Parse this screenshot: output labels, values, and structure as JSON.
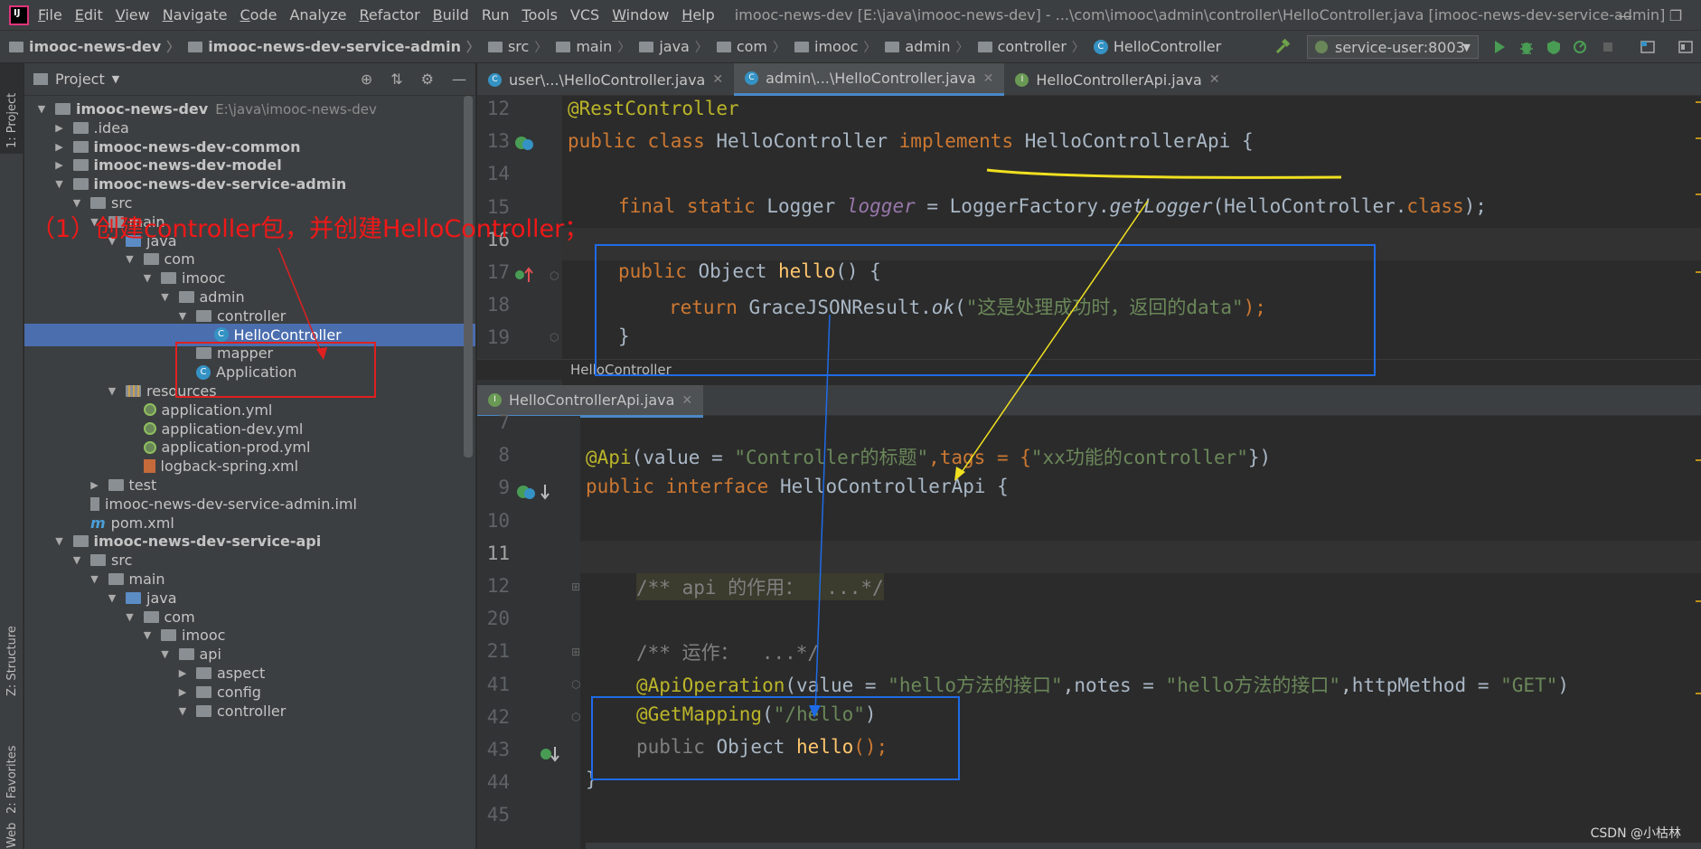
{
  "menubar": {
    "items": [
      {
        "label": "File",
        "u": "F",
        "rest": "ile"
      },
      {
        "label": "Edit",
        "u": "E",
        "rest": "dit"
      },
      {
        "label": "View",
        "u": "V",
        "rest": "iew"
      },
      {
        "label": "Navigate",
        "u": "N",
        "rest": "avigate"
      },
      {
        "label": "Code",
        "u": "C",
        "rest": "ode"
      },
      {
        "label": "Analyze",
        "u": "",
        "rest": "Analyze"
      },
      {
        "label": "Refactor",
        "u": "R",
        "rest": "efactor"
      },
      {
        "label": "Build",
        "u": "B",
        "rest": "uild"
      },
      {
        "label": "Run",
        "u": "",
        "rest": "Run"
      },
      {
        "label": "Tools",
        "u": "T",
        "rest": "ools"
      },
      {
        "label": "VCS",
        "u": "",
        "rest": "VCS"
      },
      {
        "label": "Window",
        "u": "W",
        "rest": "indow"
      },
      {
        "label": "Help",
        "u": "H",
        "rest": "elp"
      }
    ],
    "window_title": "imooc-news-dev [E:\\java\\imooc-news-dev] - ...\\com\\imooc\\admin\\controller\\HelloController.java [imooc-news-dev-service-admin]",
    "logo_text": "IJ"
  },
  "navbar": {
    "crumbs": [
      "imooc-news-dev",
      "imooc-news-dev-service-admin",
      "src",
      "main",
      "java",
      "com",
      "imooc",
      "admin",
      "controller",
      "HelloController"
    ],
    "run_config": "service-user:8003"
  },
  "stripe": {
    "project": "1: Project",
    "structure": "Z: Structure",
    "favorites": "2: Favorites",
    "web": "Web"
  },
  "project_panel": {
    "title": "Project",
    "tree": [
      {
        "label": "imooc-news-dev",
        "path": "E:\\java\\imooc-news-dev",
        "indent": 0,
        "tw": "▼",
        "icon": "folder",
        "bold": true
      },
      {
        "label": ".idea",
        "indent": 1,
        "tw": "▶",
        "icon": "folder"
      },
      {
        "label": "imooc-news-dev-common",
        "indent": 1,
        "tw": "▶",
        "icon": "folder",
        "bold": true
      },
      {
        "label": "imooc-news-dev-model",
        "indent": 1,
        "tw": "▶",
        "icon": "folder",
        "bold": true
      },
      {
        "label": "imooc-news-dev-service-admin",
        "indent": 1,
        "tw": "▼",
        "icon": "folder",
        "bold": true
      },
      {
        "label": "src",
        "indent": 2,
        "tw": "▼",
        "icon": "folder"
      },
      {
        "label": "main",
        "indent": 3,
        "tw": "▼",
        "icon": "folder"
      },
      {
        "label": "java",
        "indent": 4,
        "tw": "▼",
        "icon": "src"
      },
      {
        "label": "com",
        "indent": 5,
        "tw": "▼",
        "icon": "folder"
      },
      {
        "label": "imooc",
        "indent": 6,
        "tw": "▼",
        "icon": "folder"
      },
      {
        "label": "admin",
        "indent": 7,
        "tw": "▼",
        "icon": "folder"
      },
      {
        "label": "controller",
        "indent": 8,
        "tw": "▼",
        "icon": "folder"
      },
      {
        "label": "HelloController",
        "indent": 9,
        "tw": "",
        "icon": "class",
        "selected": true
      },
      {
        "label": "mapper",
        "indent": 8,
        "tw": "",
        "icon": "folder"
      },
      {
        "label": "Application",
        "indent": 8,
        "tw": "",
        "icon": "class"
      },
      {
        "label": "resources",
        "indent": 4,
        "tw": "▼",
        "icon": "res"
      },
      {
        "label": "application.yml",
        "indent": 5,
        "tw": "",
        "icon": "yml"
      },
      {
        "label": "application-dev.yml",
        "indent": 5,
        "tw": "",
        "icon": "yml"
      },
      {
        "label": "application-prod.yml",
        "indent": 5,
        "tw": "",
        "icon": "yml"
      },
      {
        "label": "logback-spring.xml",
        "indent": 5,
        "tw": "",
        "icon": "xml"
      },
      {
        "label": "test",
        "indent": 3,
        "tw": "▶",
        "icon": "folder"
      },
      {
        "label": "imooc-news-dev-service-admin.iml",
        "indent": 2,
        "tw": "",
        "icon": "iml"
      },
      {
        "label": "pom.xml",
        "indent": 2,
        "tw": "",
        "icon": "maven"
      },
      {
        "label": "imooc-news-dev-service-api",
        "indent": 1,
        "tw": "▼",
        "icon": "folder",
        "bold": true
      },
      {
        "label": "src",
        "indent": 2,
        "tw": "▼",
        "icon": "folder"
      },
      {
        "label": "main",
        "indent": 3,
        "tw": "▼",
        "icon": "folder"
      },
      {
        "label": "java",
        "indent": 4,
        "tw": "▼",
        "icon": "src"
      },
      {
        "label": "com",
        "indent": 5,
        "tw": "▼",
        "icon": "folder"
      },
      {
        "label": "imooc",
        "indent": 6,
        "tw": "▼",
        "icon": "folder"
      },
      {
        "label": "api",
        "indent": 7,
        "tw": "▼",
        "icon": "folder"
      },
      {
        "label": "aspect",
        "indent": 8,
        "tw": "▶",
        "icon": "folder"
      },
      {
        "label": "config",
        "indent": 8,
        "tw": "▶",
        "icon": "folder"
      },
      {
        "label": "controller",
        "indent": 8,
        "tw": "▼",
        "icon": "folder"
      }
    ]
  },
  "annotation": "（1）创建controller包，并创建HelloController；",
  "top_editor": {
    "tabs": [
      {
        "label": "user\\...\\HelloController.java",
        "kind": "class"
      },
      {
        "label": "admin\\...\\HelloController.java",
        "kind": "class",
        "active": true
      },
      {
        "label": "HelloControllerApi.java",
        "kind": "interface"
      }
    ],
    "breadcrumb": "HelloController",
    "lines": [
      "12",
      "13",
      "14",
      "15",
      "16",
      "17",
      "18",
      "19"
    ],
    "code": {
      "l12": "@RestController",
      "l13_kw1": "public class",
      "l13_name": " HelloController ",
      "l13_kw2": "implements",
      "l13_rest": " HelloControllerApi {",
      "l15_kw": "final static",
      "l15_a": " Logger ",
      "l15_fld": "logger",
      "l15_b": " = LoggerFactory.",
      "l15_it": "getLogger",
      "l15_c": "(HelloController.",
      "l15_kw2": "class",
      "l15_d": ");",
      "l17_kw": "public",
      "l17_a": " Object ",
      "l17_fn": "hello",
      "l17_b": "() {",
      "l18_kw": "return",
      "l18_a": " GraceJSONResult.",
      "l18_it": "ok",
      "l18_b": "(",
      "l18_str": "\"这是处理成功时，返回的data\"",
      "l18_c": ");",
      "l19": "}"
    }
  },
  "bottom_editor": {
    "tab": "HelloControllerApi.java",
    "lines": [
      "7",
      "8",
      "9",
      "10",
      "11",
      "12",
      "20",
      "21",
      "41",
      "42",
      "43",
      "44",
      "45"
    ],
    "code": {
      "l8_an": "@Api",
      "l8_a": "(value = ",
      "l8_str": "\"Controller的标题\"",
      "l8_b": ",tags = {",
      "l8_str2": "\"xx功能的controller\"",
      "l8_c": "})",
      "l9_kw": "public interface",
      "l9_rest": " HelloControllerApi {",
      "l12": "/** api 的作用：  ...*/",
      "l21": "/** 运作：  ...*/",
      "l41_an": "@ApiOperation",
      "l41_a": "(value = ",
      "l41_str": "\"hello方法的接口\"",
      "l41_b": ",notes = ",
      "l41_str2": "\"hello方法的接口\"",
      "l41_c": ",httpMethod = ",
      "l41_str3": "\"GET\"",
      "l41_d": ")",
      "l42_an": "@GetMapping",
      "l42_a": "(",
      "l42_str": "\"/hello\"",
      "l42_b": ")",
      "l43_kw": "public",
      "l43_a": " Object ",
      "l43_fn": "hello",
      "l43_b": "();",
      "l44": "}"
    }
  },
  "watermark": "CSDN @小枯林",
  "colors": {
    "annotation_red": "#e02020",
    "annotation_blue": "#1e6be6",
    "annotation_yellow": "#f0e020",
    "selection": "#4b6eaf"
  }
}
